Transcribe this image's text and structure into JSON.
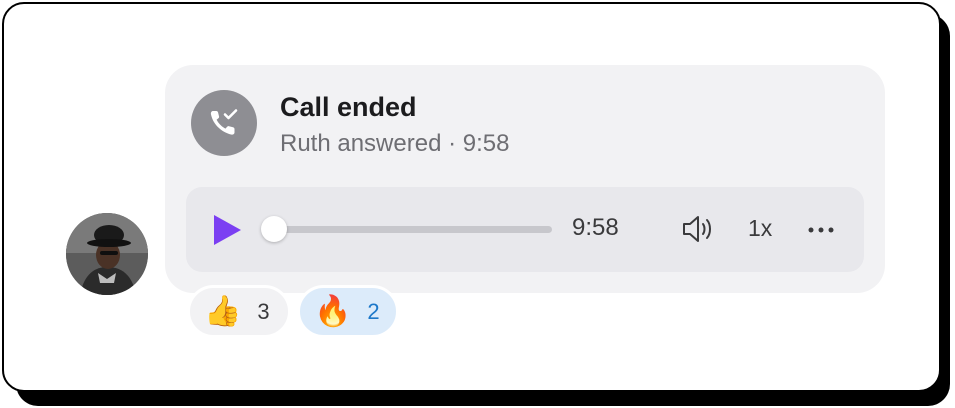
{
  "call": {
    "title": "Call ended",
    "subtitle": "Ruth answered · 9:58",
    "icon": "phone-check-icon"
  },
  "player": {
    "duration": "9:58",
    "progress": 0.0,
    "speed": "1x",
    "play_icon": "play-icon",
    "volume_icon": "volume-icon",
    "more_icon": "more-horizontal-icon",
    "accent_color": "#7b3ff2"
  },
  "reactions": [
    {
      "emoji": "👍",
      "count": "3"
    },
    {
      "emoji": "🔥",
      "count": "2"
    }
  ],
  "avatar": {
    "icon": "avatar-photo"
  }
}
